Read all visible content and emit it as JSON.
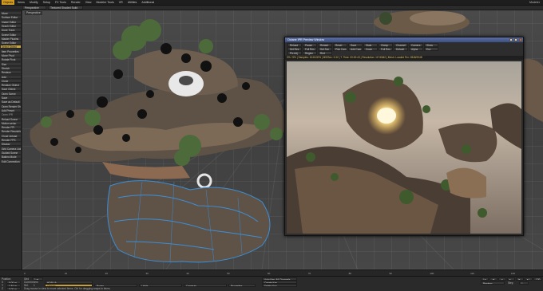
{
  "menu": {
    "items": [
      "Objects",
      "Items",
      "Modify",
      "Setup",
      "FX Tools",
      "Render",
      "View",
      "Modeler Tools",
      "VR",
      "Utilities",
      "Additional"
    ],
    "active_index": 0,
    "title": "Modeler"
  },
  "toolbar2": {
    "view_mode": "Perspective",
    "shading": "Textured Shaded Solid"
  },
  "left_toolbar": [
    {
      "label": "Move",
      "kind": "normal"
    },
    {
      "label": "Surface Editor",
      "kind": "normal"
    },
    {
      "label": "Image Editor",
      "kind": "normal"
    },
    {
      "label": "Graph Editor",
      "kind": "normal"
    },
    {
      "label": "Dope Track",
      "kind": "normal"
    },
    {
      "label": "Scene Editor",
      "kind": "normal"
    },
    {
      "label": "Master Plugins",
      "kind": "normal"
    },
    {
      "label": "Scene Editor",
      "kind": "normal"
    },
    {
      "label": "Select Object",
      "kind": "highlight"
    },
    {
      "label": "Item Properties",
      "kind": "normal"
    },
    {
      "label": "Move Pivot",
      "kind": "normal"
    },
    {
      "label": "Rotate Pivot",
      "kind": "normal"
    },
    {
      "label": "Size",
      "kind": "normal"
    },
    {
      "label": "Stretch",
      "kind": "normal"
    },
    {
      "label": "Replace",
      "kind": "normal"
    },
    {
      "label": "Add",
      "kind": "normal"
    },
    {
      "label": "Clone",
      "kind": "normal"
    },
    {
      "label": "Replace Object",
      "kind": "normal"
    },
    {
      "label": "Save Object",
      "kind": "normal"
    },
    {
      "label": "Open Scene",
      "kind": "normal"
    },
    {
      "label": "Save",
      "kind": "normal"
    },
    {
      "label": "Save as Default",
      "kind": "normal"
    },
    {
      "label": "Open Render Shell",
      "kind": "normal"
    },
    {
      "label": "Add Preset",
      "kind": "normal"
    },
    {
      "label": "Open IPR",
      "kind": "header"
    },
    {
      "label": "Reload Scene",
      "kind": "normal"
    },
    {
      "label": "Motion setup",
      "kind": "normal"
    },
    {
      "label": "Render FPI",
      "kind": "normal"
    },
    {
      "label": "Render Resolution",
      "kind": "normal"
    },
    {
      "label": "Cloud Upload",
      "kind": "normal"
    },
    {
      "label": "Render FPS",
      "kind": "normal"
    },
    {
      "label": "Display",
      "kind": "normal"
    },
    {
      "label": "Grid Camera Light",
      "kind": "normal"
    },
    {
      "label": "Guided Scene",
      "kind": "normal"
    },
    {
      "label": "Baking Mode",
      "kind": "normal"
    },
    {
      "label": "Edit Connection",
      "kind": "normal"
    }
  ],
  "preview": {
    "title": "Octane IPR Preview Window",
    "buttons_row1": [
      "Reload",
      "Pause",
      "Restart",
      "Reset",
      "Save",
      "Stats",
      "Clamp",
      "Channel",
      "Camera",
      "Show"
    ],
    "buttons_row2": [
      "Set Res",
      "Full Res",
      "Set Scn",
      "Pick Cam",
      "Add Cam",
      "Zoom",
      "Full Res",
      "Default",
      "Alpha",
      "Env"
    ],
    "buttons_row3": [
      "Pic Adj",
      "Region",
      "Rnd"
    ],
    "status": "0% / 5% | Samples: 104/100% | MS/Sec: 3.32 | T. Time: 00:00:43 | Resolution: 1174/640 | Mesh: Loaded Tex: 2848/2048"
  },
  "timeline": {
    "ticks": [
      "0",
      "10",
      "20",
      "30",
      "40",
      "50",
      "60",
      "70",
      "80",
      "90",
      "100",
      "110",
      "120"
    ]
  },
  "bottom": {
    "position_label": "Position",
    "x_label": "X",
    "x_value": "0.00 m",
    "y_label": "Y",
    "y_value": "1.84 m",
    "z_label": "Z",
    "z_value": "0.00 m",
    "grid_label": "Grid",
    "grid_value": "1 m",
    "current_item_label": "Current Item",
    "current_item_value": "HDRI IA",
    "objects_label": "Objects",
    "bones_label": "Bones",
    "lights_label": "Lights",
    "cameras_label": "Cameras",
    "properties_label": "Properties",
    "selected_label": "Sel:",
    "selected_value": "1",
    "status_message": "Drag mouse in view to move selected items. Ctrl for dragging snaps to items.",
    "auto_key_label": "Auto Key: All Channels",
    "create_key_label": "Create Key",
    "delete_key_label": "Delete Key",
    "preview_label": "Preview",
    "step_label": "Step",
    "step_value": "1",
    "frame_end": "120"
  },
  "colors": {
    "accent": "#d39a22",
    "highlight": "#caa640",
    "preview_title": "#4a5f94"
  }
}
